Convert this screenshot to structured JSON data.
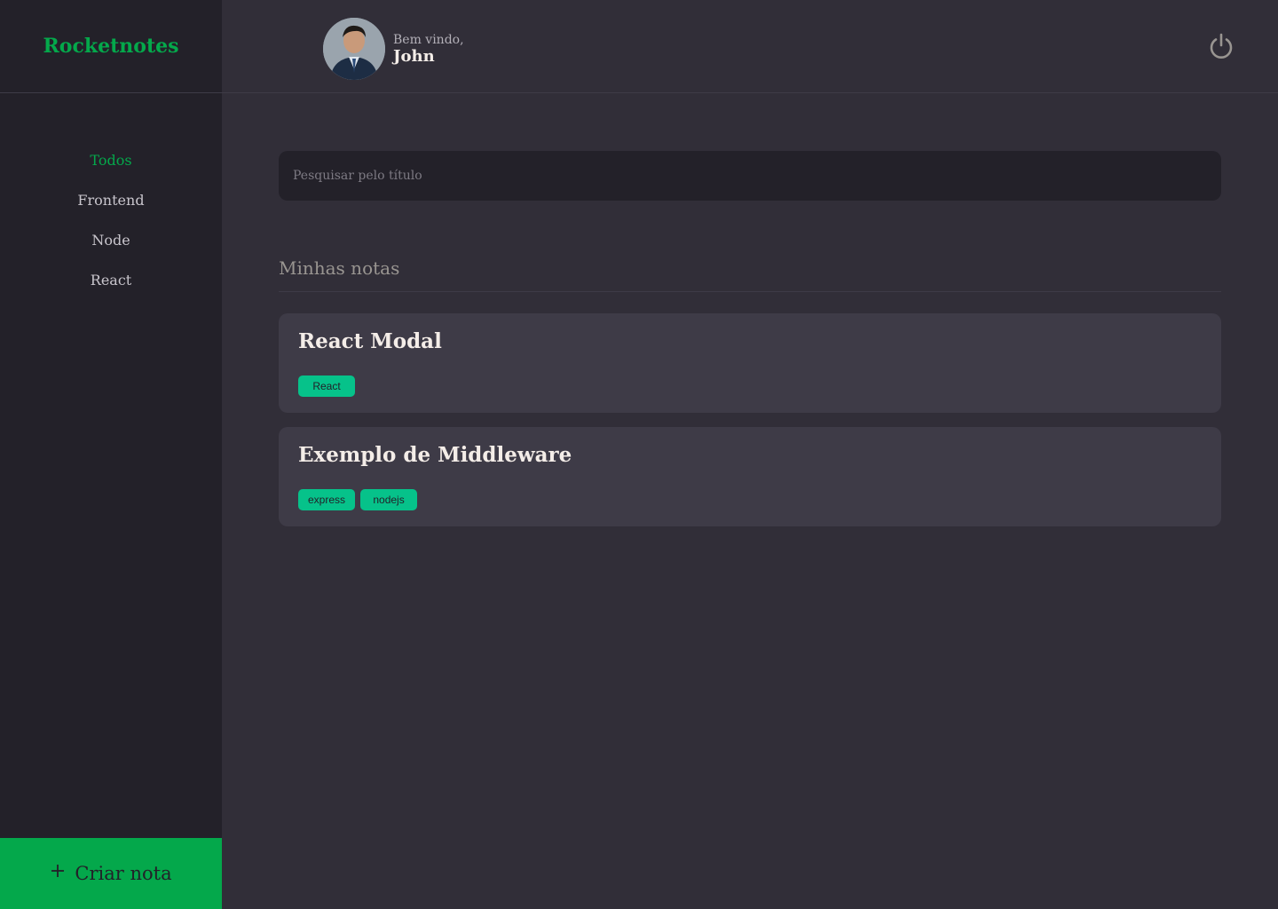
{
  "colors": {
    "accent": "#04a84b",
    "tag": "#06c28a",
    "background": "#312e38",
    "sidebar": "#232129",
    "card": "#3e3b47"
  },
  "brand": "Rocketnotes",
  "sidebar": {
    "items": [
      {
        "label": "Todos",
        "active": true
      },
      {
        "label": "Frontend",
        "active": false
      },
      {
        "label": "Node",
        "active": false
      },
      {
        "label": "React",
        "active": false
      }
    ],
    "create_label": "Criar nota",
    "create_icon": "plus-icon"
  },
  "header": {
    "greeting": "Bem vindo,",
    "user_name": "John",
    "avatar_icon": "user-avatar",
    "logout_icon": "power-icon"
  },
  "search": {
    "placeholder": "Pesquisar pelo título",
    "value": ""
  },
  "main": {
    "section_title": "Minhas notas",
    "notes": [
      {
        "title": "React Modal",
        "tags": [
          "React"
        ]
      },
      {
        "title": "Exemplo de Middleware",
        "tags": [
          "express",
          "nodejs"
        ]
      }
    ]
  }
}
